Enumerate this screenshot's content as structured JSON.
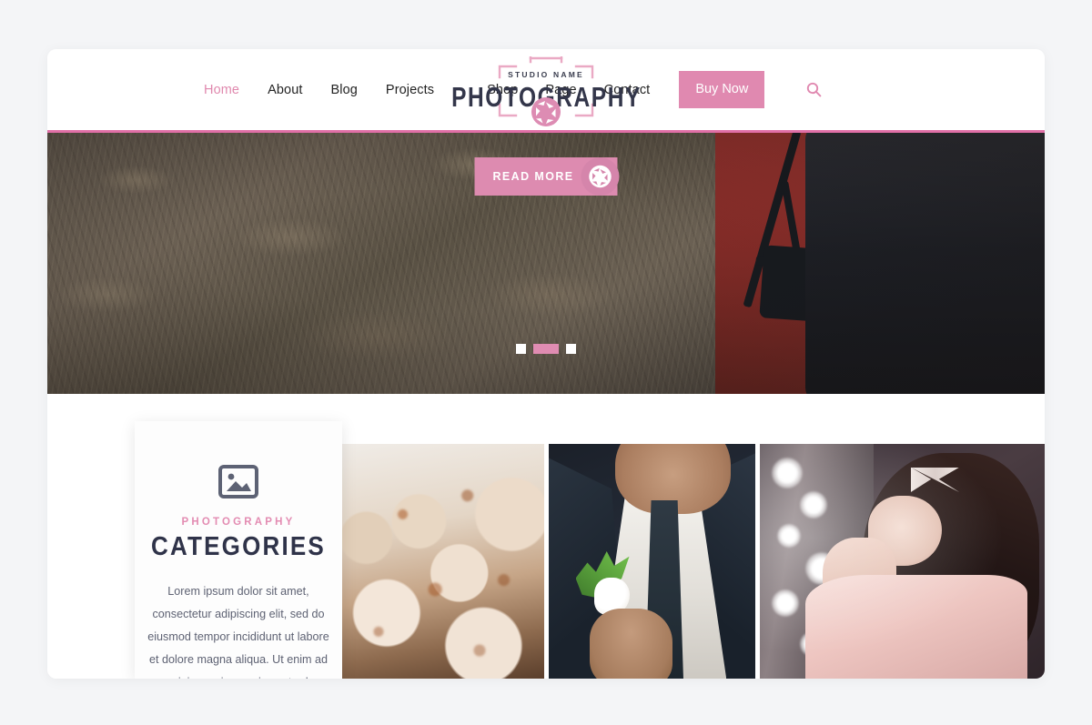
{
  "theme": {
    "accent_pink": "#e089b0",
    "accent_pink_dark": "#e06fa6",
    "heading_navy": "#2f3349",
    "body_text": "#5e6273",
    "page_background": "#f4f5f7",
    "card_background": "#ffffff"
  },
  "header": {
    "nav_left": [
      {
        "label": "Home",
        "active": true
      },
      {
        "label": "About",
        "active": false
      },
      {
        "label": "Blog",
        "active": false
      },
      {
        "label": "Projects",
        "active": false
      }
    ],
    "nav_right": [
      {
        "label": "Shop"
      },
      {
        "label": "Page"
      },
      {
        "label": "Contact"
      }
    ],
    "buy_now_label": "Buy Now",
    "search_icon": "search-icon"
  },
  "logo": {
    "studio_text": "STUDIO NAME",
    "brand_text": "PHOTOGRAPHY",
    "aperture_icon": "aperture-icon",
    "bracket_decoration": "corner-brackets"
  },
  "hero": {
    "read_more_label": "READ MORE",
    "read_more_icon": "aperture-icon",
    "slides": [
      {
        "index": 1,
        "active": false
      },
      {
        "index": 2,
        "active": true
      },
      {
        "index": 3,
        "active": false
      }
    ],
    "image_description": "Photographer in red jacket carrying a black backpack with camera gear in a dry grass field"
  },
  "categories_card": {
    "icon": "image-placeholder-icon",
    "eyebrow": "PHOTOGRAPHY",
    "title": "CATEGORIES",
    "body": "Lorem ipsum dolor sit amet, consectetur adipiscing elit, sed do eiusmod tempor incididunt ut labore et dolore magna aliqua. Ut enim ad minim veniam, quis nostrud"
  },
  "gallery": [
    {
      "name": "gallery-item-cupcakes",
      "description": "Close-up of frosted cupcakes with crumb topping"
    },
    {
      "name": "gallery-item-groom",
      "description": "Groom in dark suit adjusting his tie with a boutonniere"
    },
    {
      "name": "gallery-item-vanity",
      "description": "Woman in pink dress seated at a lit vanity mirror"
    }
  ]
}
